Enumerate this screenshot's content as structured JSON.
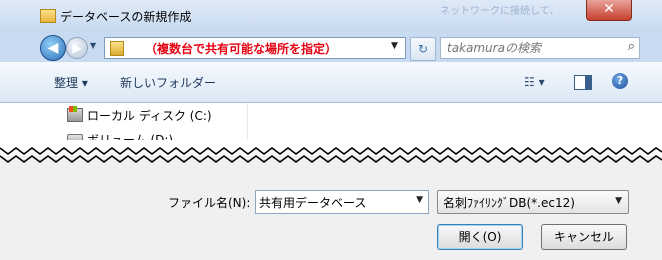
{
  "window": {
    "title": "データベースの新規作成",
    "close_glyph": "✕",
    "ghost_text": "ネットワークに接続して、接続を..."
  },
  "address": {
    "path": "（複数台で共有可能な場所を指定）",
    "back_glyph": "◀",
    "forward_glyph": "▶",
    "history_glyph": "▼",
    "dropdown_glyph": "▼",
    "refresh_glyph": "↻"
  },
  "search": {
    "placeholder": "takamuraの検索",
    "icon": "search-icon",
    "icon_glyph": "⌕"
  },
  "toolbar": {
    "organize": "整理 ▾",
    "new_folder": "新しいフォルダー",
    "view_glyph": "☷ ▾",
    "help_glyph": "?"
  },
  "nav": {
    "items": [
      {
        "label": "ローカル ディスク (C:)",
        "icon": "local-disk-icon"
      },
      {
        "label": "ボリューム (D:)",
        "icon": "volume-drive-icon"
      }
    ],
    "scroll_up_glyph": "▲"
  },
  "form": {
    "filename_label": "ファイル名(N):",
    "filename_value": "共有用データベース",
    "filename_dropdown_glyph": "▼",
    "filetype_value": "名刺ﾌｧｲﾘﾝｸﾞDB(*.ec12)",
    "filetype_dropdown_glyph": "▼",
    "open_button": "開く(O)",
    "cancel_button": "キャンセル"
  },
  "colors": {
    "address_path": "#e60012",
    "title_bar": "#c7daf0"
  }
}
